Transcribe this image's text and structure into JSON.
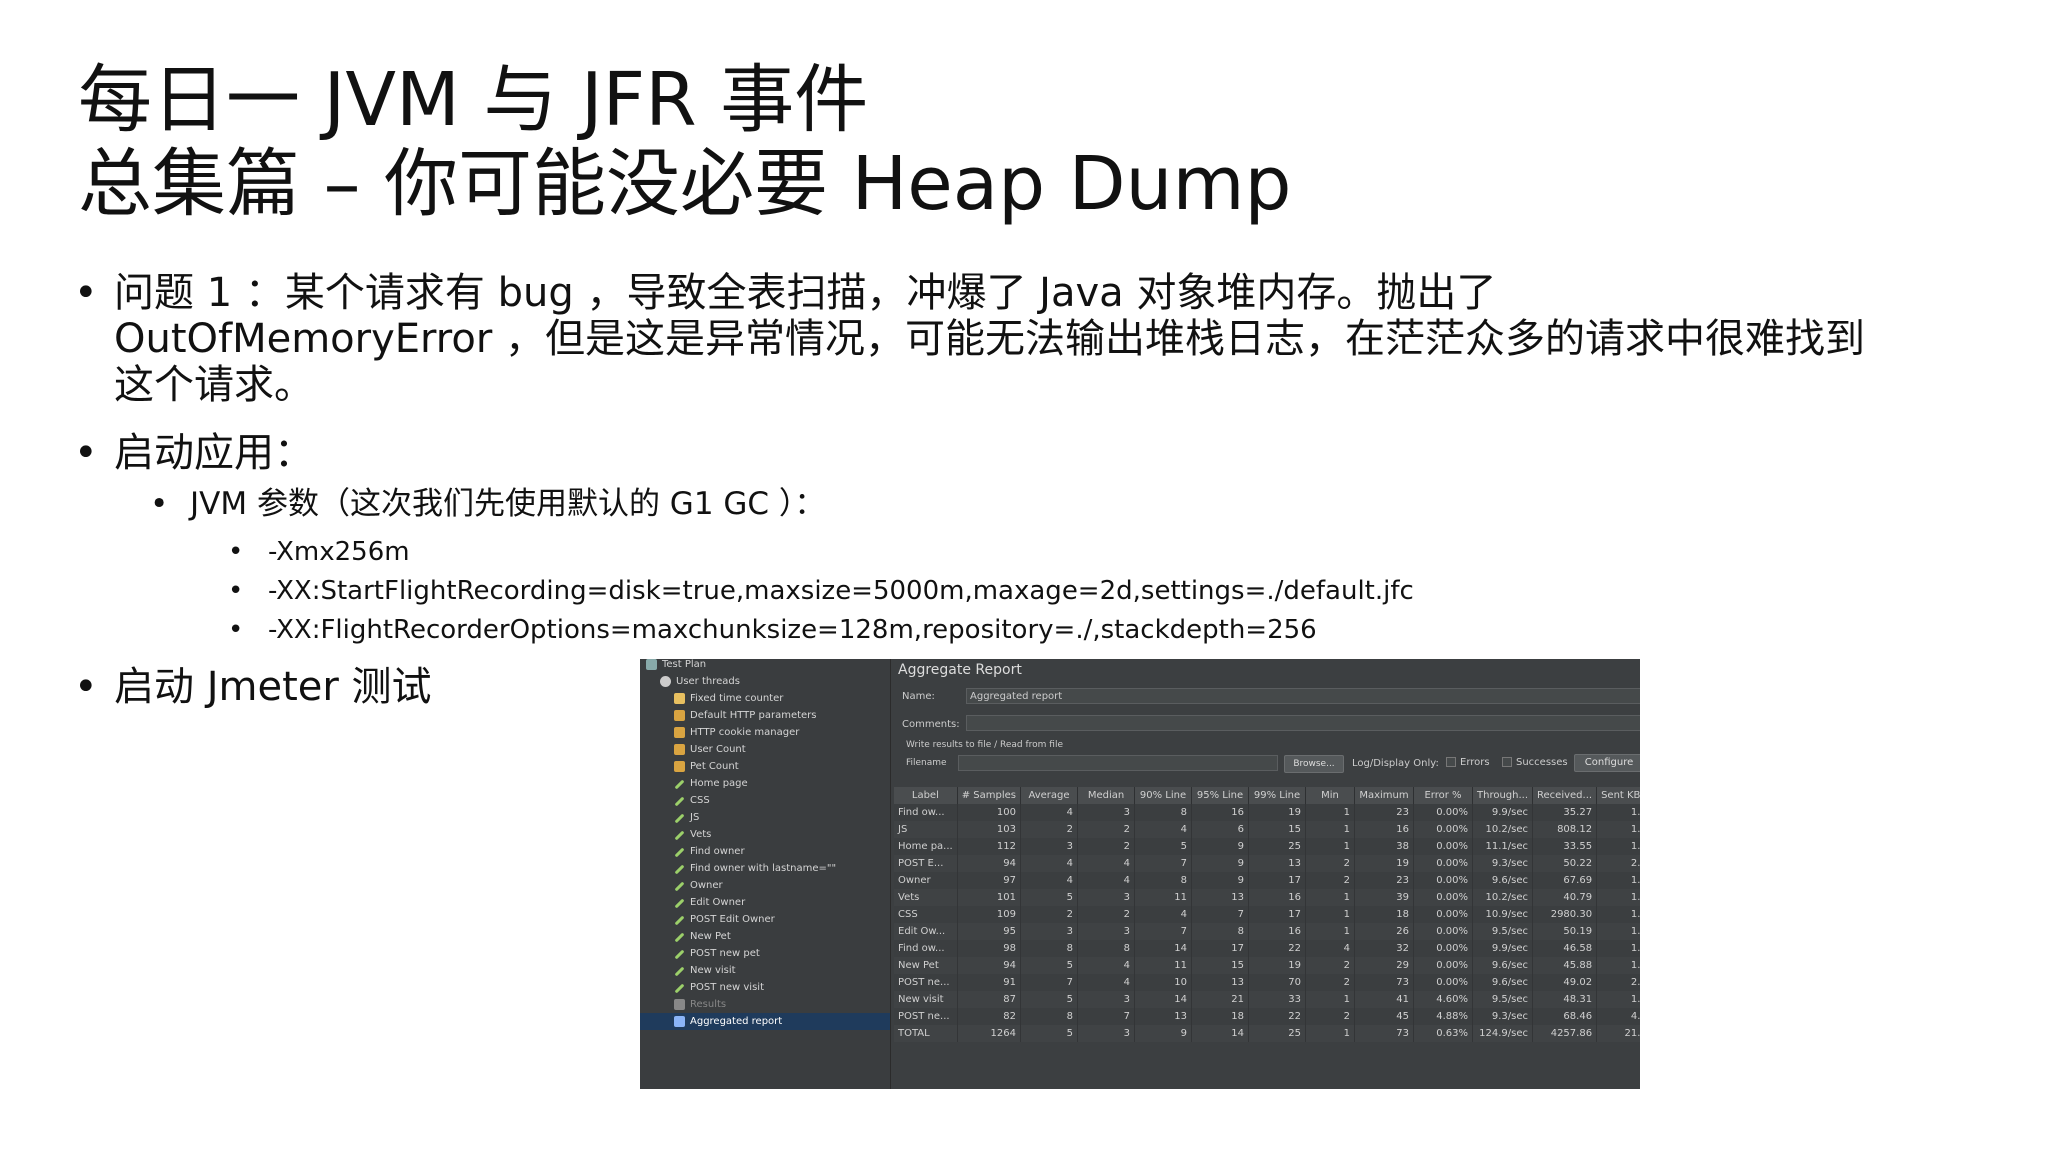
{
  "title": {
    "line1": "每日一 JVM 与 JFR 事件",
    "line2": "总集篇 – 你可能没必要  Heap Dump"
  },
  "bullets": {
    "b1_line1": "问题 1  ：某个请求有   bug  ，导致全表扫描，冲爆了   Java  对象堆内存。抛出了",
    "b1_line2": "OutOfMemoryError  ，但是这是异常情况，可能无法输出堆栈日志，在茫茫众多的请求中很难找到",
    "b1_line3": "这个请求。",
    "b2": "启动应用：",
    "b2_sub": "JVM  参数（这次我们先使用默认的   G1 GC  ）：",
    "b2_args": [
      "-Xmx256m",
      "-XX:StartFlightRecording=disk=true,maxsize=5000m,maxage=2d,settings=./default.jfc",
      "-XX:FlightRecorderOptions=maxchunksize=128m,repository=./,stackdepth=256"
    ],
    "b3": "启动  Jmeter  测试"
  },
  "jmeter": {
    "tree": [
      {
        "label": "Test Plan",
        "icon": "test-plan-icon",
        "indent": 0
      },
      {
        "label": "User threads",
        "icon": "gear-icon",
        "indent": 1
      },
      {
        "label": "Fixed time counter",
        "icon": "timer-icon",
        "indent": 2
      },
      {
        "label": "Default HTTP parameters",
        "icon": "config-icon",
        "indent": 2
      },
      {
        "label": "HTTP cookie manager",
        "icon": "config-icon",
        "indent": 2
      },
      {
        "label": "User Count",
        "icon": "config-icon",
        "indent": 2
      },
      {
        "label": "Pet Count",
        "icon": "config-icon",
        "indent": 2
      },
      {
        "label": "Home page",
        "icon": "sampler-icon",
        "indent": 2
      },
      {
        "label": "CSS",
        "icon": "sampler-icon",
        "indent": 2
      },
      {
        "label": "JS",
        "icon": "sampler-icon",
        "indent": 2
      },
      {
        "label": "Vets",
        "icon": "sampler-icon",
        "indent": 2
      },
      {
        "label": "Find owner",
        "icon": "sampler-icon",
        "indent": 2
      },
      {
        "label": "Find owner with lastname=\"\"",
        "icon": "sampler-icon",
        "indent": 2
      },
      {
        "label": "Owner",
        "icon": "sampler-icon",
        "indent": 2
      },
      {
        "label": "Edit Owner",
        "icon": "sampler-icon",
        "indent": 2
      },
      {
        "label": "POST Edit Owner",
        "icon": "sampler-icon",
        "indent": 2
      },
      {
        "label": "New Pet",
        "icon": "sampler-icon",
        "indent": 2
      },
      {
        "label": "POST new pet",
        "icon": "sampler-icon",
        "indent": 2
      },
      {
        "label": "New visit",
        "icon": "sampler-icon",
        "indent": 2
      },
      {
        "label": "POST new visit",
        "icon": "sampler-icon",
        "indent": 2
      },
      {
        "label": "Results",
        "icon": "listener-icon",
        "indent": 2
      },
      {
        "label": "Aggregated report",
        "icon": "chart-icon",
        "indent": 2
      }
    ],
    "panel_title": "Aggregate Report",
    "name_label": "Name:",
    "name_value": "Aggregated report",
    "comments_label": "Comments:",
    "write_results": "Write results to file / Read from file",
    "filename_label": "Filename",
    "browse": "Browse...",
    "log_display": "Log/Display Only:",
    "errors": "Errors",
    "successes": "Successes",
    "configure": "Configure",
    "columns": [
      "Label",
      "# Samples",
      "Average",
      "Median",
      "90% Line",
      "95% Line",
      "99% Line",
      "Min",
      "Maximum",
      "Error %",
      "Through...",
      "Received...",
      "Sent KB"
    ],
    "rows": [
      [
        "Find ow...",
        "100",
        "4",
        "3",
        "8",
        "16",
        "19",
        "1",
        "23",
        "0.00%",
        "9.9/sec",
        "35.27",
        "1."
      ],
      [
        "JS",
        "103",
        "2",
        "2",
        "4",
        "6",
        "15",
        "1",
        "16",
        "0.00%",
        "10.2/sec",
        "808.12",
        "1."
      ],
      [
        "Home pa...",
        "112",
        "3",
        "2",
        "5",
        "9",
        "25",
        "1",
        "38",
        "0.00%",
        "11.1/sec",
        "33.55",
        "1."
      ],
      [
        "POST E...",
        "94",
        "4",
        "4",
        "7",
        "9",
        "13",
        "2",
        "19",
        "0.00%",
        "9.3/sec",
        "50.22",
        "2."
      ],
      [
        "Owner",
        "97",
        "4",
        "4",
        "8",
        "9",
        "17",
        "2",
        "23",
        "0.00%",
        "9.6/sec",
        "67.69",
        "1."
      ],
      [
        "Vets",
        "101",
        "5",
        "3",
        "11",
        "13",
        "16",
        "1",
        "39",
        "0.00%",
        "10.2/sec",
        "40.79",
        "1."
      ],
      [
        "CSS",
        "109",
        "2",
        "2",
        "4",
        "7",
        "17",
        "1",
        "18",
        "0.00%",
        "10.9/sec",
        "2980.30",
        "1."
      ],
      [
        "Edit Ow...",
        "95",
        "3",
        "3",
        "7",
        "8",
        "16",
        "1",
        "26",
        "0.00%",
        "9.5/sec",
        "50.19",
        "1."
      ],
      [
        "Find ow...",
        "98",
        "8",
        "8",
        "14",
        "17",
        "22",
        "4",
        "32",
        "0.00%",
        "9.9/sec",
        "46.58",
        "1."
      ],
      [
        "New Pet",
        "94",
        "5",
        "4",
        "11",
        "15",
        "19",
        "2",
        "29",
        "0.00%",
        "9.6/sec",
        "45.88",
        "1."
      ],
      [
        "POST ne...",
        "91",
        "7",
        "4",
        "10",
        "13",
        "70",
        "2",
        "73",
        "0.00%",
        "9.6/sec",
        "49.02",
        "2."
      ],
      [
        "New visit",
        "87",
        "5",
        "3",
        "14",
        "21",
        "33",
        "1",
        "41",
        "4.60%",
        "9.5/sec",
        "48.31",
        "1."
      ],
      [
        "POST ne...",
        "82",
        "8",
        "7",
        "13",
        "18",
        "22",
        "2",
        "45",
        "4.88%",
        "9.3/sec",
        "68.46",
        "4."
      ],
      [
        "TOTAL",
        "1264",
        "5",
        "3",
        "9",
        "14",
        "25",
        "1",
        "73",
        "0.63%",
        "124.9/sec",
        "4257.86",
        "21."
      ]
    ]
  }
}
